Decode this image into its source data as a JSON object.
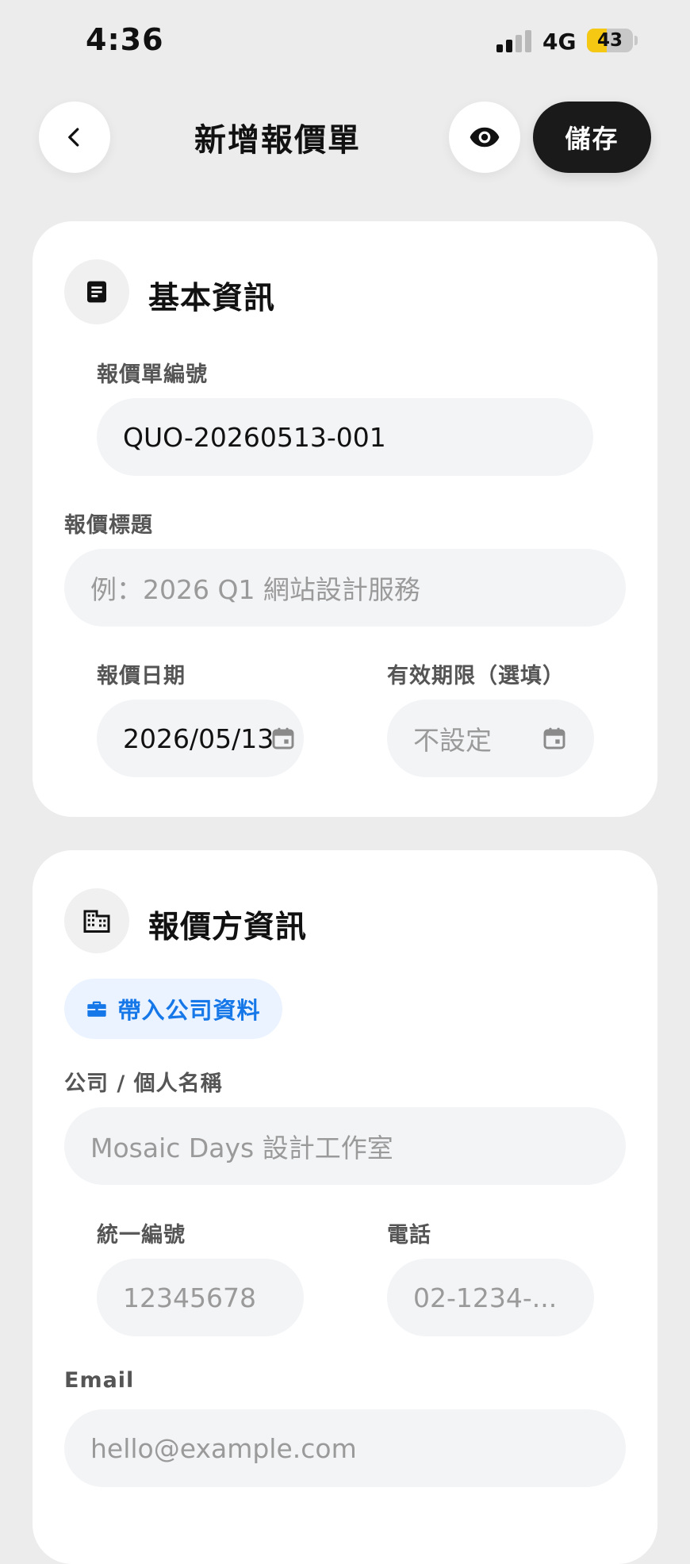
{
  "status_bar": {
    "time": "4:36",
    "network": "4G",
    "battery": "43",
    "battery_level": 0.43
  },
  "header": {
    "title": "新增報價單",
    "save_label": "儲存"
  },
  "basic_info": {
    "title": "基本資訊",
    "quote_number": {
      "label": "報價單編號",
      "value": "QUO-20260513-001"
    },
    "quote_title": {
      "label": "報價標題",
      "placeholder": "例：2026 Q1 網站設計服務"
    },
    "quote_date": {
      "label": "報價日期",
      "value": "2026/05/13"
    },
    "valid_until": {
      "label": "有效期限（選填）",
      "placeholder": "不設定"
    }
  },
  "issuer_info": {
    "title": "報價方資訊",
    "import_label": "帶入公司資料",
    "company_name": {
      "label": "公司 / 個人名稱",
      "placeholder": "Mosaic Days 設計工作室"
    },
    "tax_id": {
      "label": "統一編號",
      "placeholder": "12345678"
    },
    "phone": {
      "label": "電話",
      "placeholder": "02-1234-..."
    },
    "email": {
      "label": "Email",
      "placeholder": "hello@example.com"
    }
  },
  "colors": {
    "background": "#ececec",
    "card": "#ffffff",
    "input": "#f3f4f6",
    "primary_button": "#1a1a1a",
    "accent_blue": "#1677e8",
    "accent_blue_bg": "#eaf3ff",
    "battery_yellow": "#f5c813"
  },
  "icons": {
    "back": "chevron-left-icon",
    "preview": "eye-icon",
    "basic_info": "document-icon",
    "issuer": "building-icon",
    "import": "briefcase-icon",
    "date": "calendar-icon"
  }
}
